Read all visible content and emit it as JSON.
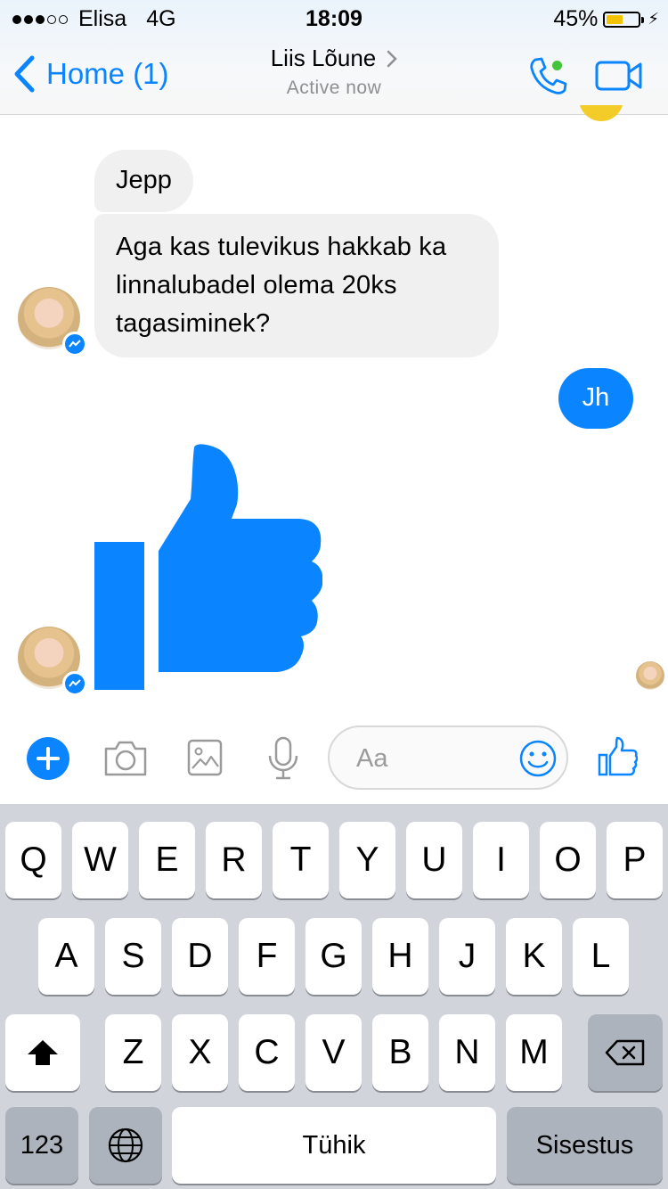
{
  "status_bar": {
    "signal_bars": 3,
    "signal_total": 5,
    "carrier": "Elisa",
    "network": "4G",
    "time": "18:09",
    "battery_percent": "45%",
    "battery_level": 0.45
  },
  "nav": {
    "back_label": "Home (1)",
    "title": "Liis Lõune",
    "subtitle": "Active now",
    "accent_color": "#0a84ff",
    "presence_color": "#44c43a"
  },
  "messages": [
    {
      "from": "contact",
      "text": "Jepp"
    },
    {
      "from": "contact",
      "text": "Aga kas tulevikus hakkab ka linnalubadel olema 20ks tagasiminek?"
    },
    {
      "from": "me",
      "text": "Jh"
    },
    {
      "from": "contact",
      "sticker": "thumbs-up-icon"
    }
  ],
  "composer": {
    "icons": [
      "plus-icon",
      "camera-icon",
      "image-icon",
      "microphone-icon",
      "smiley-icon",
      "thumbs-up-icon"
    ],
    "placeholder": "Aa"
  },
  "keyboard": {
    "row1": [
      "Q",
      "W",
      "E",
      "R",
      "T",
      "Y",
      "U",
      "I",
      "O",
      "P"
    ],
    "row2": [
      "A",
      "S",
      "D",
      "F",
      "G",
      "H",
      "J",
      "K",
      "L"
    ],
    "row3": [
      "Z",
      "X",
      "C",
      "V",
      "B",
      "N",
      "M"
    ],
    "numbers_label": "123",
    "space_label": "Tühik",
    "return_label": "Sisestus"
  }
}
